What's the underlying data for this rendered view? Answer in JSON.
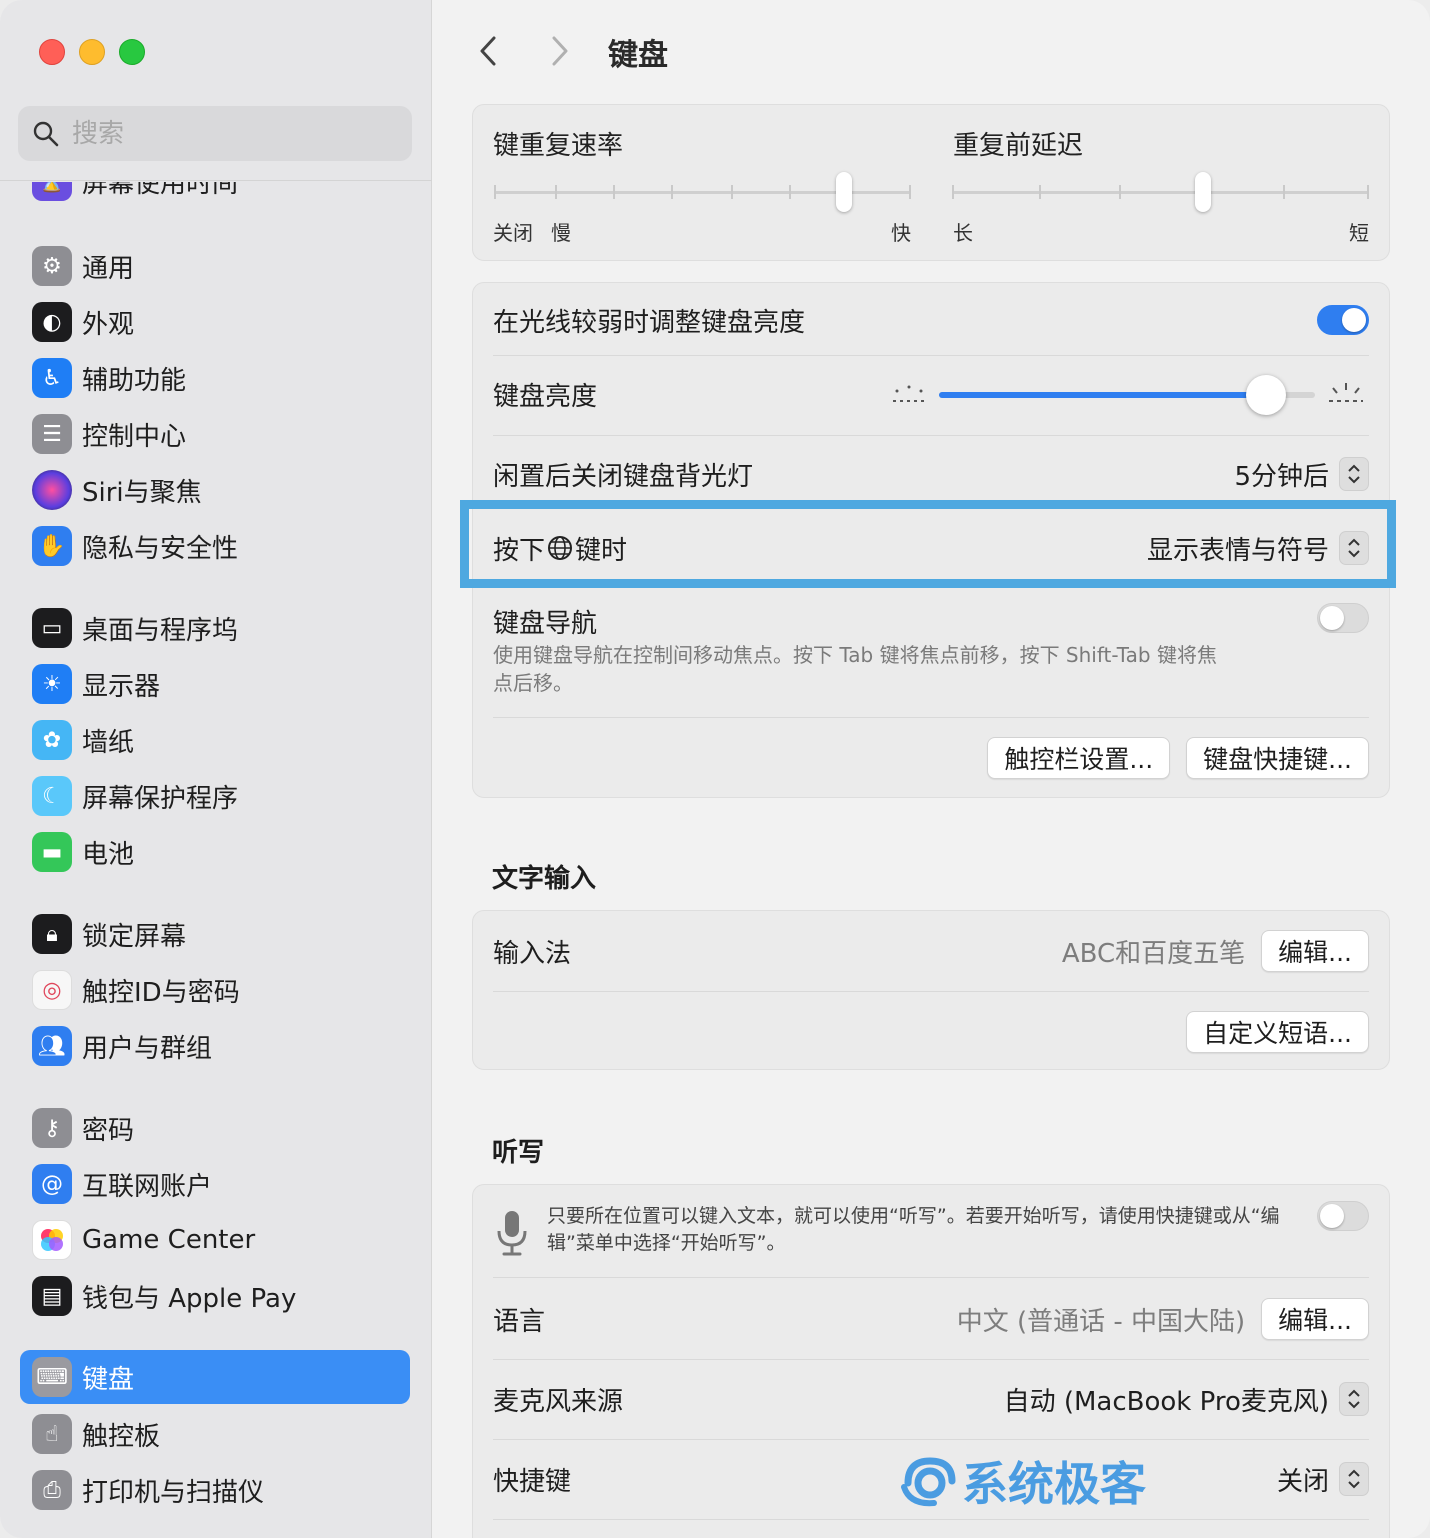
{
  "window": {
    "colors": {
      "close": "#ff5f57",
      "minimize": "#febc2e",
      "zoom": "#28c840",
      "accent": "#3a8ef5"
    }
  },
  "sidebar": {
    "search_placeholder": "搜索",
    "items": [
      {
        "label": "屏幕使用时间",
        "icon": "hourglass-icon",
        "color": "#6a4ee0"
      },
      {
        "label": "通用",
        "icon": "gear-icon",
        "color": "#8e8e93"
      },
      {
        "label": "外观",
        "icon": "appearance-icon",
        "color": "#1c1c1e"
      },
      {
        "label": "辅助功能",
        "icon": "accessibility-icon",
        "color": "#1f7ef5"
      },
      {
        "label": "控制中心",
        "icon": "control-center-icon",
        "color": "#8e8e93"
      },
      {
        "label": "Siri与聚焦",
        "icon": "siri-icon",
        "color": "#7a3fd6"
      },
      {
        "label": "隐私与安全性",
        "icon": "hand-icon",
        "color": "#2f7ef0"
      },
      {
        "label": "桌面与程序坞",
        "icon": "dock-icon",
        "color": "#1c1c1e"
      },
      {
        "label": "显示器",
        "icon": "sun-icon",
        "color": "#1f7ef5"
      },
      {
        "label": "墙纸",
        "icon": "flower-icon",
        "color": "#45b6f5"
      },
      {
        "label": "屏幕保护程序",
        "icon": "screensaver-icon",
        "color": "#5ac8fa"
      },
      {
        "label": "电池",
        "icon": "battery-icon",
        "color": "#34c759"
      },
      {
        "label": "锁定屏幕",
        "icon": "lock-icon",
        "color": "#1c1c1e"
      },
      {
        "label": "触控ID与密码",
        "icon": "fingerprint-icon",
        "color": "#f2f2f2"
      },
      {
        "label": "用户与群组",
        "icon": "users-icon",
        "color": "#2f7ef0"
      },
      {
        "label": "密码",
        "icon": "key-icon",
        "color": "#8e8e93"
      },
      {
        "label": "互联网账户",
        "icon": "at-icon",
        "color": "#2f7ef0"
      },
      {
        "label": "Game Center",
        "icon": "game-center-icon",
        "color": "#ffffff"
      },
      {
        "label": "钱包与 Apple Pay",
        "icon": "wallet-icon",
        "color": "#1c1c1e"
      },
      {
        "label": "键盘",
        "icon": "keyboard-icon",
        "color": "#8e8e93"
      },
      {
        "label": "触控板",
        "icon": "trackpad-icon",
        "color": "#8e8e93"
      },
      {
        "label": "打印机与扫描仪",
        "icon": "printer-icon",
        "color": "#8e8e93"
      }
    ]
  },
  "header": {
    "title": "键盘"
  },
  "repeat": {
    "rate_label": "键重复速率",
    "rate_off": "关闭",
    "rate_slow": "慢",
    "rate_fast": "快",
    "rate_value": 0.84,
    "delay_label": "重复前延迟",
    "delay_long": "长",
    "delay_short": "短",
    "delay_value": 0.6
  },
  "keyboard": {
    "auto_brightness_label": "在光线较弱时调整键盘亮度",
    "auto_brightness_on": true,
    "brightness_label": "键盘亮度",
    "brightness_value": 0.87,
    "backlight_off_label": "闲置后关闭键盘背光灯",
    "backlight_off_value": "5分钟后",
    "globe_label_pre": "按下",
    "globe_label_post": "键时",
    "globe_value": "显示表情与符号",
    "nav_label": "键盘导航",
    "nav_desc": "使用键盘导航在控制间移动焦点。按下 Tab 键将焦点前移，按下 Shift-Tab 键将焦点后移。",
    "nav_on": false,
    "touchbar_btn": "触控栏设置...",
    "shortcuts_btn": "键盘快捷键..."
  },
  "text_input": {
    "section": "文字输入",
    "input_label": "输入法",
    "input_value": "ABC和百度五笔",
    "edit_btn": "编辑...",
    "replace_btn": "自定义短语..."
  },
  "dictation": {
    "section": "听写",
    "desc": "只要所在位置可以键入文本，就可以使用“听写”。若要开始听写，请使用快捷键或从“编辑”菜单中选择“开始听写”。",
    "on": false,
    "lang_label": "语言",
    "lang_value": "中文 (普通话 - 中国大陆)",
    "lang_edit_btn": "编辑...",
    "mic_label": "麦克风来源",
    "mic_value": "自动 (MacBook Pro麦克风)",
    "shortcut_label": "快捷键",
    "shortcut_value": "关闭"
  },
  "watermark": "系统极客"
}
